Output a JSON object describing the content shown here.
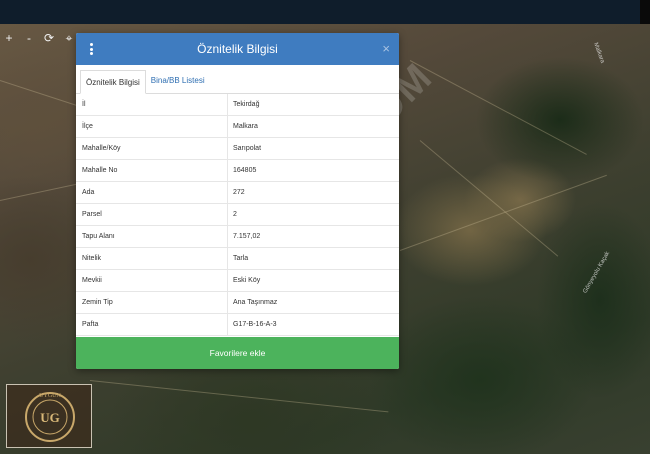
{
  "map": {
    "toolbar": {
      "plus": "+",
      "minus": "-",
      "refresh": "⟳",
      "locate": "⌖"
    },
    "road_labels": [
      "Malkara",
      "Gönyeyolu Kaçak"
    ],
    "watermark": "M.COM"
  },
  "dialog": {
    "title": "Öznitelik Bilgisi",
    "close_label": "×",
    "tabs": [
      {
        "label": "Öznitelik Bilgisi",
        "active": true
      },
      {
        "label": "Bina/BB Listesi",
        "active": false
      }
    ],
    "rows": [
      {
        "key": "İl",
        "value": "Tekirdağ"
      },
      {
        "key": "İlçe",
        "value": "Malkara"
      },
      {
        "key": "Mahalle/Köy",
        "value": "Sarıpolat"
      },
      {
        "key": "Mahalle No",
        "value": "164805"
      },
      {
        "key": "Ada",
        "value": "272"
      },
      {
        "key": "Parsel",
        "value": "2"
      },
      {
        "key": "Tapu Alanı",
        "value": "7.157,02"
      },
      {
        "key": "Nitelik",
        "value": "Tarla"
      },
      {
        "key": "Mevkii",
        "value": "Eski Köy"
      },
      {
        "key": "Zemin Tip",
        "value": "Ana Taşınmaz"
      },
      {
        "key": "Pafta",
        "value": "G17-B-16-A-3"
      }
    ],
    "favorite_button": "Favorilere ekle"
  },
  "logo": {
    "letters": "UG",
    "ring_text": "UYGUN"
  },
  "colors": {
    "header": "#3f7cc0",
    "favorite": "#4cb35c",
    "tab_link": "#2f6fb2"
  }
}
